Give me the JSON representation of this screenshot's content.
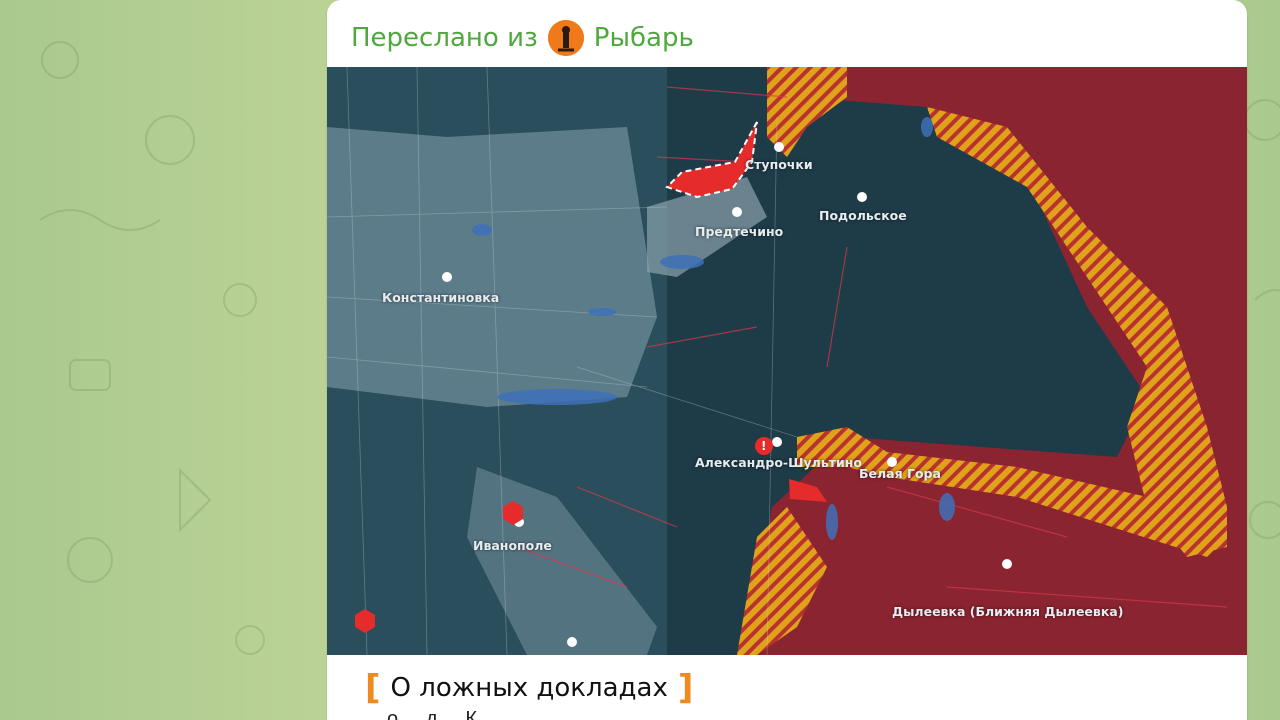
{
  "post": {
    "forwarded_prefix": "Переслано из",
    "channel_name": "Рыбарь",
    "title": "О ложных докладах",
    "partial_text": "о ... д ... К ... ..."
  },
  "map": {
    "labels": {
      "stupochki": "Ступочки",
      "podolskoe": "Подольское",
      "predtechino": "Предтечино",
      "konstantinovka": "Константиновка",
      "aleksandro": "Александро-Шультино",
      "belaya_gora": "Белая Гора",
      "ivanopole": "Иванополе",
      "dyleevka": "Дылеевка (Ближняя Дылеевка)"
    },
    "icons": {
      "alert": "!"
    }
  }
}
